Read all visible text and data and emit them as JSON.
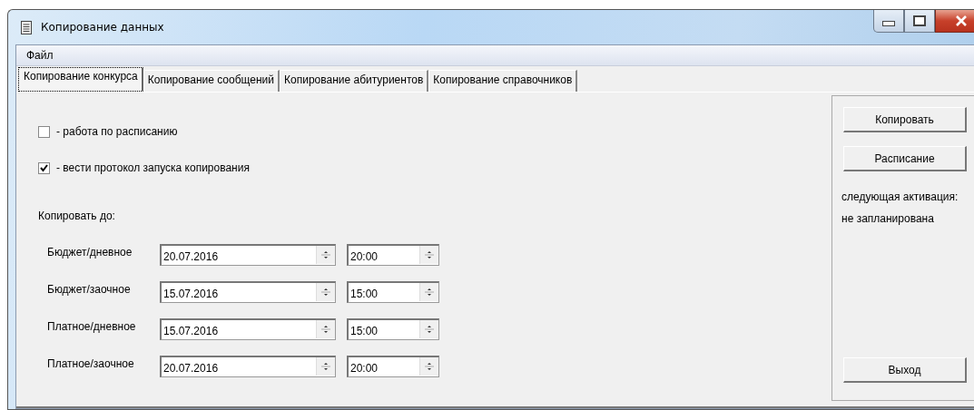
{
  "window": {
    "title": "Копирование данных"
  },
  "menu": [
    {
      "label": "Файл"
    }
  ],
  "tabs": [
    {
      "label": "Копирование конкурса",
      "selected": true
    },
    {
      "label": "Копирование сообщений",
      "selected": false
    },
    {
      "label": "Копирование абитуриентов",
      "selected": false
    },
    {
      "label": "Копирование справочников",
      "selected": false
    }
  ],
  "options": [
    {
      "label": "- работа по расписанию",
      "checked": false
    },
    {
      "label": "- вести протокол запуска копирования",
      "checked": true
    }
  ],
  "copy_until": {
    "label": "Копировать до:",
    "rows": [
      {
        "label": "Бюджет/дневное",
        "date": "20.07.2016",
        "time": "20:00"
      },
      {
        "label": "Бюджет/заочное",
        "date": "15.07.2016",
        "time": "15:00"
      },
      {
        "label": "Платное/дневное",
        "date": "15.07.2016",
        "time": "15:00"
      },
      {
        "label": "Платное/заочное",
        "date": "20.07.2016",
        "time": "20:00"
      }
    ]
  },
  "side_panel": {
    "buttons": [
      "Копировать",
      "Расписание"
    ],
    "next_activation_label": "следующая активация:",
    "next_activation_value": "не запланирована",
    "exit_button": "Выход"
  }
}
